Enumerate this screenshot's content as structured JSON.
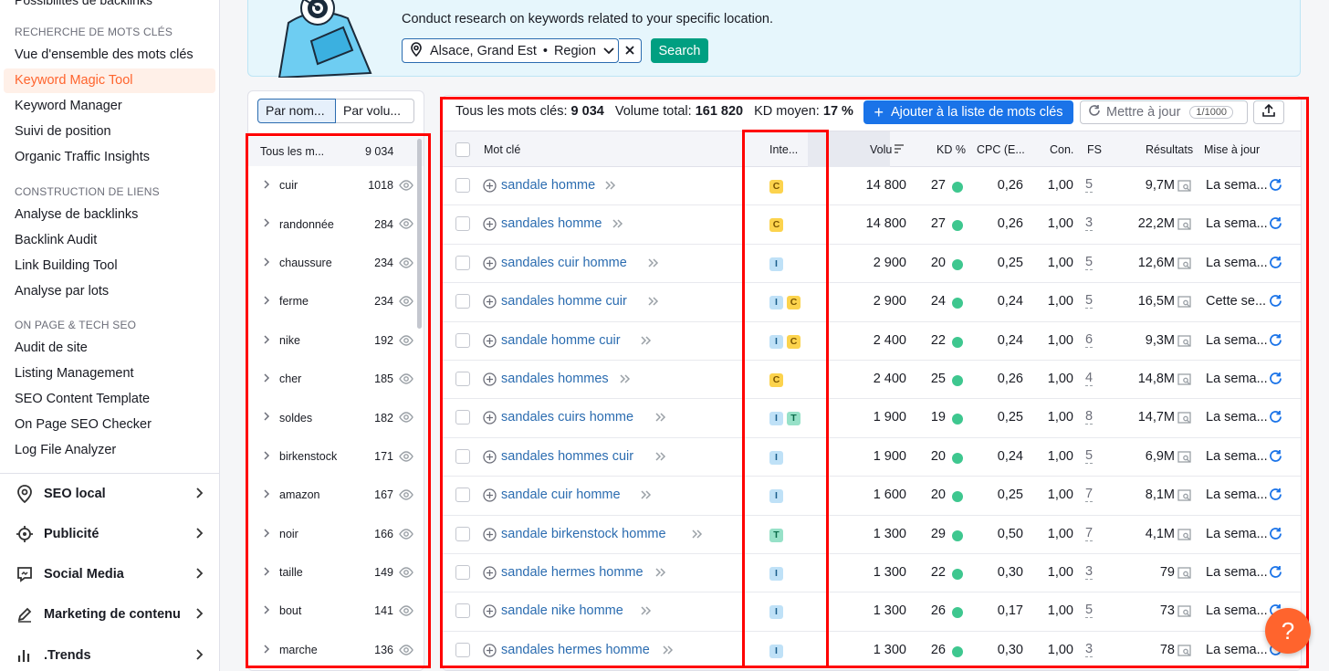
{
  "sidebar": {
    "top_partial": "Possibilités de backlinks",
    "sections": [
      {
        "title": "RECHERCHE DE MOTS CLÉS",
        "items": [
          "Vue d'ensemble des mots clés",
          "Keyword Magic Tool",
          "Keyword Manager",
          "Suivi de position",
          "Organic Traffic Insights"
        ]
      },
      {
        "title": "CONSTRUCTION DE LIENS",
        "items": [
          "Analyse de backlinks",
          "Backlink Audit",
          "Link Building Tool",
          "Analyse par lots"
        ]
      },
      {
        "title": "ON PAGE & TECH SEO",
        "items": [
          "Audit de site",
          "Listing Management",
          "SEO Content Template",
          "On Page SEO Checker",
          "Log File Analyzer"
        ]
      }
    ],
    "active_item": "Keyword Magic Tool",
    "groups": [
      "SEO local",
      "Publicité",
      "Social Media",
      "Marketing de contenu",
      ".Trends"
    ]
  },
  "location": {
    "description": "Conduct research on keywords related to your specific location.",
    "value": "Alsace, Grand Est",
    "type": "Region",
    "search_label": "Search"
  },
  "groups_panel": {
    "tab_by_name": "Par nom...",
    "tab_by_volume": "Par volu...",
    "all_label": "Tous les m...",
    "all_count": "9 034",
    "items": [
      {
        "name": "cuir",
        "count": "1018"
      },
      {
        "name": "randonnée",
        "count": "284"
      },
      {
        "name": "chaussure",
        "count": "234"
      },
      {
        "name": "ferme",
        "count": "234"
      },
      {
        "name": "nike",
        "count": "192"
      },
      {
        "name": "cher",
        "count": "185"
      },
      {
        "name": "soldes",
        "count": "182"
      },
      {
        "name": "birkenstock",
        "count": "171"
      },
      {
        "name": "amazon",
        "count": "167"
      },
      {
        "name": "noir",
        "count": "166"
      },
      {
        "name": "taille",
        "count": "149"
      },
      {
        "name": "bout",
        "count": "141"
      },
      {
        "name": "marche",
        "count": "136"
      }
    ]
  },
  "stats": {
    "all_keywords_label": "Tous les mots clés:",
    "all_keywords_value": "9 034",
    "total_volume_label": "Volume total:",
    "total_volume_value": "161 820",
    "avg_kd_label": "KD moyen:",
    "avg_kd_value": "17 %"
  },
  "toolbar": {
    "add_label": "Ajouter à la liste de mots clés",
    "update_label": "Mettre à jour",
    "quota": "1/1000"
  },
  "columns": {
    "keyword": "Mot clé",
    "intent": "Inte...",
    "volume": "Volu",
    "kd": "KD %",
    "cpc": "CPC (E...",
    "con": "Con.",
    "fs": "FS",
    "results": "Résultats",
    "updated": "Mise à jour"
  },
  "rows": [
    {
      "kw": "sandale homme",
      "intents": [
        "C"
      ],
      "vol": "14 800",
      "kd": "27",
      "cpc": "0,26",
      "con": "1,00",
      "fs": "5",
      "res": "9,7M",
      "upd": "La sema..."
    },
    {
      "kw": "sandales homme",
      "intents": [
        "C"
      ],
      "vol": "14 800",
      "kd": "27",
      "cpc": "0,26",
      "con": "1,00",
      "fs": "3",
      "res": "22,2M",
      "upd": "La sema..."
    },
    {
      "kw": "sandales cuir homme",
      "intents": [
        "I"
      ],
      "vol": "2 900",
      "kd": "20",
      "cpc": "0,25",
      "con": "1,00",
      "fs": "5",
      "res": "12,6M",
      "upd": "La sema..."
    },
    {
      "kw": "sandales homme cuir",
      "intents": [
        "I",
        "C"
      ],
      "vol": "2 900",
      "kd": "24",
      "cpc": "0,24",
      "con": "1,00",
      "fs": "5",
      "res": "16,5M",
      "upd": "Cette se..."
    },
    {
      "kw": "sandale homme cuir",
      "intents": [
        "I",
        "C"
      ],
      "vol": "2 400",
      "kd": "22",
      "cpc": "0,24",
      "con": "1,00",
      "fs": "6",
      "res": "9,3M",
      "upd": "La sema..."
    },
    {
      "kw": "sandales hommes",
      "intents": [
        "C"
      ],
      "vol": "2 400",
      "kd": "25",
      "cpc": "0,26",
      "con": "1,00",
      "fs": "4",
      "res": "14,8M",
      "upd": "La sema..."
    },
    {
      "kw": "sandales cuirs homme",
      "intents": [
        "I",
        "T"
      ],
      "vol": "1 900",
      "kd": "19",
      "cpc": "0,25",
      "con": "1,00",
      "fs": "8",
      "res": "14,7M",
      "upd": "La sema..."
    },
    {
      "kw": "sandales hommes cuir",
      "intents": [
        "I"
      ],
      "vol": "1 900",
      "kd": "20",
      "cpc": "0,24",
      "con": "1,00",
      "fs": "5",
      "res": "6,9M",
      "upd": "La sema..."
    },
    {
      "kw": "sandale cuir homme",
      "intents": [
        "I"
      ],
      "vol": "1 600",
      "kd": "20",
      "cpc": "0,25",
      "con": "1,00",
      "fs": "7",
      "res": "8,1M",
      "upd": "La sema..."
    },
    {
      "kw": "sandale birkenstock homme",
      "intents": [
        "T"
      ],
      "vol": "1 300",
      "kd": "29",
      "cpc": "0,50",
      "con": "1,00",
      "fs": "7",
      "res": "4,1M",
      "upd": "La sema..."
    },
    {
      "kw": "sandale hermes homme",
      "intents": [
        "I"
      ],
      "vol": "1 300",
      "kd": "22",
      "cpc": "0,30",
      "con": "1,00",
      "fs": "3",
      "res": "79",
      "upd": "La sema..."
    },
    {
      "kw": "sandale nike homme",
      "intents": [
        "I"
      ],
      "vol": "1 300",
      "kd": "26",
      "cpc": "0,17",
      "con": "1,00",
      "fs": "5",
      "res": "73",
      "upd": "La sema..."
    },
    {
      "kw": "sandales hermes homme",
      "intents": [
        "I"
      ],
      "vol": "1 300",
      "kd": "26",
      "cpc": "0,30",
      "con": "1,00",
      "fs": "3",
      "res": "78",
      "upd": "La sema..."
    }
  ],
  "help_label": "?",
  "colors": {
    "accent": "#ff642d",
    "link": "#2b6cb0",
    "primary_button": "#1a73e8",
    "search_button": "#009f81",
    "highlight": "#ff0000"
  }
}
